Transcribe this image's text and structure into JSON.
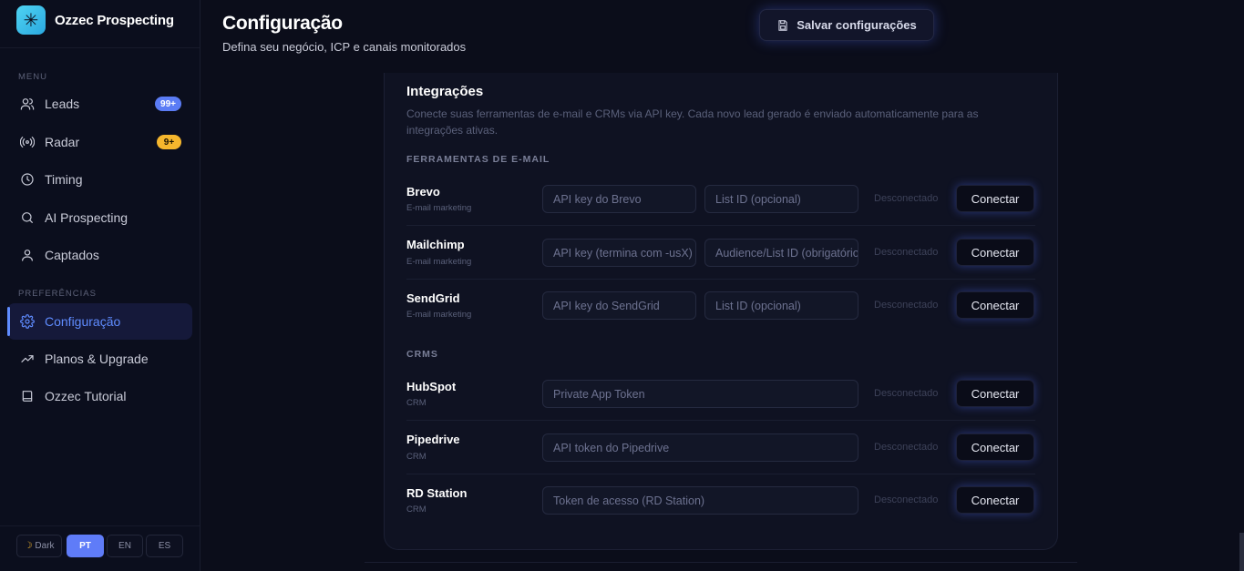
{
  "brand": {
    "name": "Ozzec Prospecting"
  },
  "sidebar": {
    "menu_label": "MENU",
    "prefs_label": "PREFERÊNCIAS",
    "items": [
      {
        "label": "Leads",
        "icon": "users-icon",
        "badge": "99+"
      },
      {
        "label": "Radar",
        "icon": "radar-icon",
        "badge": "9+"
      },
      {
        "label": "Timing",
        "icon": "clock-icon"
      },
      {
        "label": "AI Prospecting",
        "icon": "search-icon"
      },
      {
        "label": "Captados",
        "icon": "user-icon"
      },
      {
        "label": "Configuração",
        "icon": "gear-icon",
        "active": true
      },
      {
        "label": "Planos & Upgrade",
        "icon": "trending-up-icon"
      },
      {
        "label": "Ozzec Tutorial",
        "icon": "book-icon"
      }
    ],
    "theme_label": "Dark",
    "languages": [
      "PT",
      "EN",
      "ES"
    ],
    "active_language": "PT"
  },
  "header": {
    "title": "Configuração",
    "subtitle": "Defina seu negócio, ICP e canais monitorados",
    "save_label": "Salvar configurações"
  },
  "integrations": {
    "title": "Integrações",
    "description": "Conecte suas ferramentas de e-mail e CRMs via API key. Cada novo lead gerado é enviado automaticamente para as integrações ativas.",
    "email_group_label": "FERRAMENTAS DE E-MAIL",
    "crm_group_label": "CRMS",
    "status_label": "Desconectado",
    "connect_label": "Conectar",
    "email_tools": [
      {
        "name": "Brevo",
        "type": "E-mail marketing",
        "api_placeholder": "API key do Brevo",
        "list_placeholder": "List ID (opcional)"
      },
      {
        "name": "Mailchimp",
        "type": "E-mail marketing",
        "api_placeholder": "API key (termina com -usX)",
        "list_placeholder": "Audience/List ID (obrigatório)"
      },
      {
        "name": "SendGrid",
        "type": "E-mail marketing",
        "api_placeholder": "API key do SendGrid",
        "list_placeholder": "List ID (opcional)"
      }
    ],
    "crms": [
      {
        "name": "HubSpot",
        "type": "CRM",
        "token_placeholder": "Private App Token"
      },
      {
        "name": "Pipedrive",
        "type": "CRM",
        "token_placeholder": "API token do Pipedrive"
      },
      {
        "name": "RD Station",
        "type": "CRM",
        "token_placeholder": "Token de acesso (RD Station)"
      }
    ]
  },
  "colors": {
    "accent": "#5f8cff",
    "background": "#0b0d1a",
    "badge_blue": "#5b7cf5",
    "badge_yellow": "#f5b62d"
  }
}
